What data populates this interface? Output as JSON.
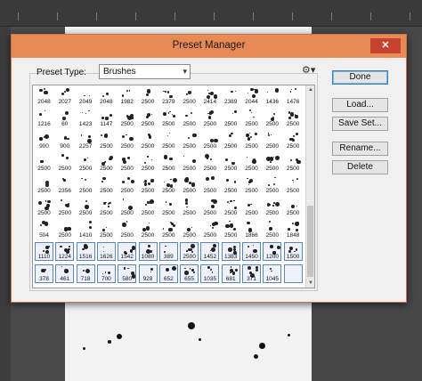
{
  "dialog": {
    "title": "Preset Manager",
    "close_label": "✕",
    "preset_type_label": "Preset Type:",
    "preset_type_value": "Brushes",
    "select_arrow": "▾",
    "gear": "⚙▾",
    "buttons": {
      "done": "Done",
      "load": "Load...",
      "save_set": "Save Set...",
      "rename": "Rename...",
      "delete": "Delete"
    }
  },
  "brush_rows": [
    [
      "2048",
      "2027",
      "2049",
      "2048",
      "1982",
      "2500",
      "2379",
      "2500",
      "2414",
      "2389",
      "2044",
      "1436",
      "1476"
    ],
    [
      "1216",
      "60",
      "1423",
      "1147",
      "2500",
      "2500",
      "2500",
      "2500",
      "2500",
      "2500",
      "2500",
      "2500",
      "2500"
    ],
    [
      "900",
      "900",
      "2257",
      "2500",
      "2500",
      "2500",
      "2500",
      "2500",
      "2500",
      "2500",
      "2500",
      "2500",
      "2500"
    ],
    [
      "2500",
      "2500",
      "2500",
      "2500",
      "2500",
      "2500",
      "2500",
      "2500",
      "2500",
      "2500",
      "2500",
      "2500",
      "2500"
    ],
    [
      "2500",
      "2356",
      "2500",
      "2500",
      "2500",
      "2500",
      "2500",
      "2500",
      "2500",
      "2500",
      "2500",
      "2500",
      "2500"
    ],
    [
      "2500",
      "2500",
      "2500",
      "2500",
      "2500",
      "2500",
      "2500",
      "2500",
      "2500",
      "2500",
      "2500",
      "2500",
      "2500"
    ],
    [
      "504",
      "2500",
      "1410",
      "2500",
      "2500",
      "2500",
      "2500",
      "2500",
      "2500",
      "2500",
      "1866",
      "2500",
      "1848"
    ],
    [
      "1110",
      "1224",
      "1516",
      "1626",
      "1542",
      "1080",
      "389",
      "2500",
      "1452",
      "1383",
      "1450",
      "1200",
      "1500"
    ],
    [
      "378",
      "461",
      "718",
      "700",
      "580",
      "928",
      "652",
      "655",
      "1035",
      "681",
      "371",
      "1045",
      ""
    ]
  ],
  "selected_rows": [
    7,
    8
  ],
  "highlight_color": "#5a84c8",
  "title_bar_color": "#e88a56"
}
